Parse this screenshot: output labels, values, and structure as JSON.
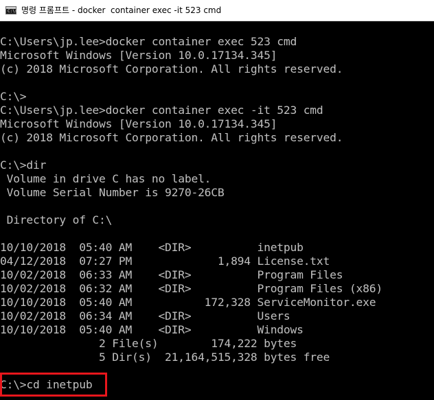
{
  "window": {
    "title": "명령 프롬프트 - docker  container exec -it 523 cmd",
    "icon": "cmd-icon",
    "icon_glyph": "C:\\>"
  },
  "console": {
    "lines": [
      "C:\\Users\\jp.lee>docker container exec 523 cmd",
      "Microsoft Windows [Version 10.0.17134.345]",
      "(c) 2018 Microsoft Corporation. All rights reserved.",
      "",
      "C:\\>",
      "C:\\Users\\jp.lee>docker container exec -it 523 cmd",
      "Microsoft Windows [Version 10.0.17134.345]",
      "(c) 2018 Microsoft Corporation. All rights reserved.",
      "",
      "C:\\>dir",
      " Volume in drive C has no label.",
      " Volume Serial Number is 9270-26CB",
      "",
      " Directory of C:\\",
      "",
      "10/10/2018  05:40 AM    <DIR>          inetpub",
      "04/12/2018  07:27 PM             1,894 License.txt",
      "10/02/2018  06:33 AM    <DIR>          Program Files",
      "10/02/2018  06:32 AM    <DIR>          Program Files (x86)",
      "10/10/2018  05:40 AM           172,328 ServiceMonitor.exe",
      "10/02/2018  06:34 AM    <DIR>          Users",
      "10/10/2018  05:40 AM    <DIR>          Windows",
      "               2 File(s)        174,222 bytes",
      "               5 Dir(s)  21,164,515,328 bytes free",
      "",
      "C:\\>cd inetpub"
    ]
  },
  "colors": {
    "console_bg": "#000000",
    "console_fg": "#c0c0c0",
    "highlight_border": "#e8161c",
    "titlebar_bg": "#ffffff"
  }
}
